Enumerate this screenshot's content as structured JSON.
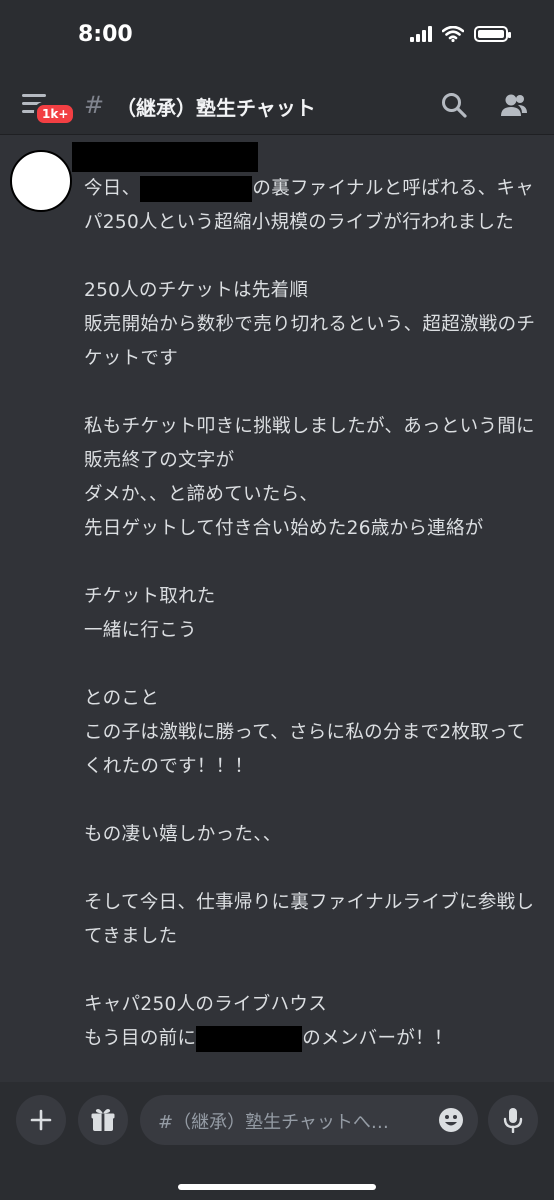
{
  "status_bar": {
    "time": "8:00"
  },
  "header": {
    "badge": "1k+",
    "channel_hash": "#",
    "channel_name": "（継承）塾生チャット",
    "icons": [
      "menu-icon",
      "search-icon",
      "members-icon"
    ]
  },
  "message": {
    "line1_before": "今日、",
    "line1_after": "の裏ファイナルと呼ばれる、キャパ250人という超縮小規模のライブが行われました",
    "paragraphs": [
      "250人のチケットは先着順\n販売開始から数秒で売り切れるという、超超激戦のチケットです",
      "私もチケット叩きに挑戦しましたが、あっという間に販売終了の文字が\nダメか、、と諦めていたら、\n先日ゲットして付き合い始めた26歳から連絡が",
      "チケット取れた\n一緒に行こう",
      "とのこと\nこの子は激戦に勝って、さらに私の分まで2枚取ってくれたのです！！！",
      "もの凄い嬉しかった、、",
      "そして今日、仕事帰りに裏ファイナルライブに参戦してきました"
    ],
    "last_line1": "キャパ250人のライブハウス",
    "last_line2_before": "もう目の前に",
    "last_line2_after": "のメンバーが！！"
  },
  "composer": {
    "placeholder": "#（継承）塾生チャットへ…",
    "icons": [
      "plus-icon",
      "gift-icon",
      "emoji-icon",
      "microphone-icon"
    ]
  },
  "colors": {
    "background": "#313338",
    "header": "#2b2d31",
    "badge": "#f23f43",
    "text": "#dbdee1"
  }
}
